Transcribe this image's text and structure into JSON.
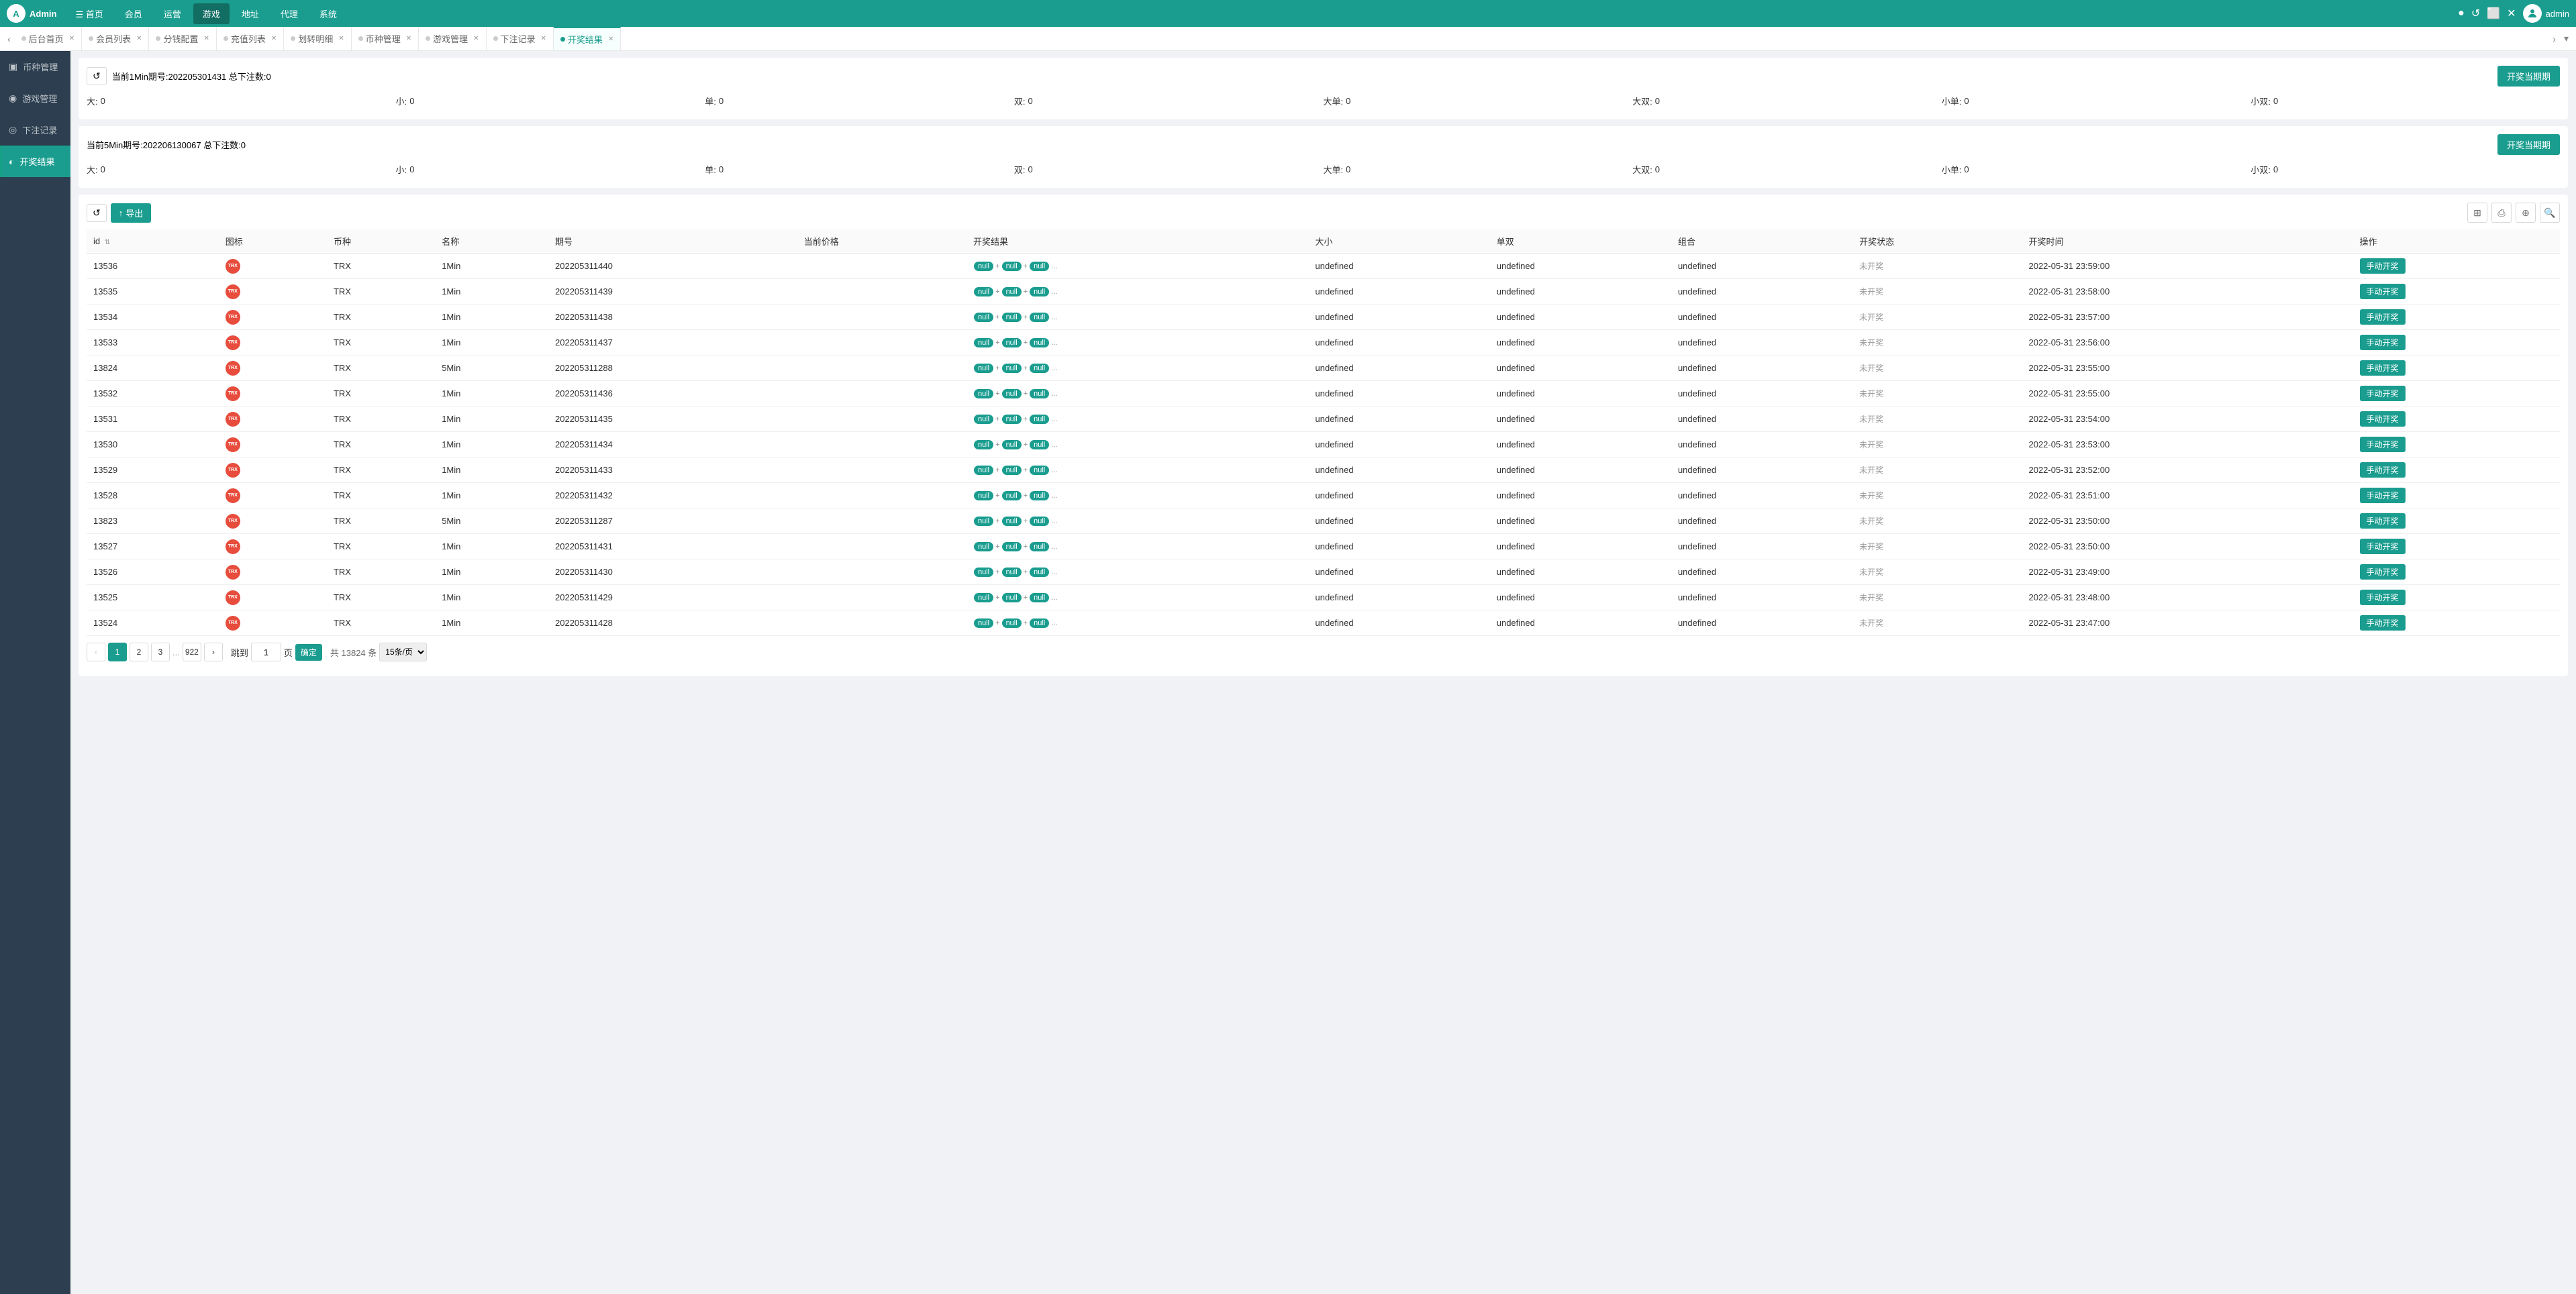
{
  "app": {
    "logo": "Admin",
    "logo_icon": "A"
  },
  "top_nav": {
    "items": [
      {
        "label": "首页",
        "icon": "☰",
        "active": false
      },
      {
        "label": "会员",
        "active": false
      },
      {
        "label": "运营",
        "active": false
      },
      {
        "label": "游戏",
        "active": true
      },
      {
        "label": "地址",
        "active": false
      },
      {
        "label": "代理",
        "active": false
      },
      {
        "label": "系统",
        "active": false
      }
    ],
    "user": "admin",
    "icons": [
      "●",
      "↺",
      "⬜",
      "✕"
    ]
  },
  "tabs": [
    {
      "label": "后台首页",
      "active": false,
      "dot": "gray",
      "closable": true
    },
    {
      "label": "会员列表",
      "active": false,
      "dot": "gray",
      "closable": true
    },
    {
      "label": "分钱配置",
      "active": false,
      "dot": "gray",
      "closable": true
    },
    {
      "label": "充值列表",
      "active": false,
      "dot": "gray",
      "closable": true
    },
    {
      "label": "划转明细",
      "active": false,
      "dot": "gray",
      "closable": true
    },
    {
      "label": "币种管理",
      "active": false,
      "dot": "gray",
      "closable": true
    },
    {
      "label": "游戏管理",
      "active": false,
      "dot": "gray",
      "closable": true
    },
    {
      "label": "下注记录",
      "active": false,
      "dot": "gray",
      "closable": true
    },
    {
      "label": "开奖结果",
      "active": true,
      "dot": "green",
      "closable": true
    }
  ],
  "sidebar": {
    "items": [
      {
        "label": "币种管理",
        "icon": "◈",
        "active": false
      },
      {
        "label": "游戏管理",
        "icon": "◉",
        "active": false
      },
      {
        "label": "下注记录",
        "icon": "◎",
        "active": false
      },
      {
        "label": "开奖结果",
        "icon": "◐",
        "active": true
      }
    ]
  },
  "period_1min": {
    "label": "当前1Min期号:202205301431 总下注数:0",
    "open_btn": "开奖当期期",
    "stats": [
      {
        "key": "大",
        "value": "0"
      },
      {
        "key": "小",
        "value": "0"
      },
      {
        "key": "单",
        "value": "0"
      },
      {
        "key": "双",
        "value": "0"
      },
      {
        "key": "大单",
        "value": "0"
      },
      {
        "key": "大双",
        "value": "0"
      },
      {
        "key": "小单",
        "value": "0"
      },
      {
        "key": "小双",
        "value": "0"
      }
    ]
  },
  "period_5min": {
    "label": "当前5Min期号:202206130067 总下注数:0",
    "open_btn": "开奖当期期",
    "stats": [
      {
        "key": "大",
        "value": "0"
      },
      {
        "key": "小",
        "value": "0"
      },
      {
        "key": "单",
        "value": "0"
      },
      {
        "key": "双",
        "value": "0"
      },
      {
        "key": "大单",
        "value": "0"
      },
      {
        "key": "大双",
        "value": "0"
      },
      {
        "key": "小单",
        "value": "0"
      },
      {
        "key": "小双",
        "value": "0"
      }
    ]
  },
  "toolbar": {
    "refresh_icon": "↺",
    "export_icon": "↑",
    "export_label": "导出",
    "tool_icons": [
      "⊞",
      "⎙",
      "⊕",
      "🔍"
    ]
  },
  "table": {
    "columns": [
      {
        "key": "id",
        "label": "id",
        "sortable": true
      },
      {
        "key": "icon",
        "label": "图标"
      },
      {
        "key": "currency",
        "label": "币种"
      },
      {
        "key": "name",
        "label": "名称"
      },
      {
        "key": "period",
        "label": "期号"
      },
      {
        "key": "price",
        "label": "当前价格"
      },
      {
        "key": "result",
        "label": "开奖结果"
      },
      {
        "key": "size",
        "label": "大小"
      },
      {
        "key": "parity",
        "label": "单双"
      },
      {
        "key": "combo",
        "label": "组合"
      },
      {
        "key": "status",
        "label": "开奖状态"
      },
      {
        "key": "time",
        "label": "开奖时间"
      },
      {
        "key": "action",
        "label": "操作"
      }
    ],
    "rows": [
      {
        "id": "13536",
        "currency": "TRX",
        "name": "1Min",
        "period": "202205311440",
        "price": "",
        "result_badges": [
          "null",
          "null",
          "null",
          "..."
        ],
        "size": "undefined",
        "parity": "undefined",
        "combo": "undefined",
        "status": "未开奖",
        "time": "2022-05-31 23:59:00",
        "action": "手动开奖",
        "action_active": true
      },
      {
        "id": "13535",
        "currency": "TRX",
        "name": "1Min",
        "period": "202205311439",
        "price": "",
        "result_badges": [
          "null",
          "null",
          "null",
          "..."
        ],
        "size": "undefined",
        "parity": "undefined",
        "combo": "undefined",
        "status": "未开奖",
        "time": "2022-05-31 23:58:00",
        "action": "手动开奖",
        "action_active": true
      },
      {
        "id": "13534",
        "currency": "TRX",
        "name": "1Min",
        "period": "202205311438",
        "price": "",
        "result_badges": [
          "null",
          "null",
          "null",
          "..."
        ],
        "size": "undefined",
        "parity": "undefined",
        "combo": "undefined",
        "status": "未开奖",
        "time": "2022-05-31 23:57:00",
        "action": "手动开奖",
        "action_active": true
      },
      {
        "id": "13533",
        "currency": "TRX",
        "name": "1Min",
        "period": "202205311437",
        "price": "",
        "result_badges": [
          "null",
          "null",
          "null",
          "..."
        ],
        "size": "undefined",
        "parity": "undefined",
        "combo": "undefined",
        "status": "未开奖",
        "time": "2022-05-31 23:56:00",
        "action": "手动开奖",
        "action_active": true
      },
      {
        "id": "13824",
        "currency": "TRX",
        "name": "5Min",
        "period": "202205311288",
        "price": "",
        "result_badges": [
          "null",
          "null",
          "null",
          "..."
        ],
        "size": "undefined",
        "parity": "undefined",
        "combo": "undefined",
        "status": "未开奖",
        "time": "2022-05-31 23:55:00",
        "action": "手动开奖",
        "action_active": true
      },
      {
        "id": "13532",
        "currency": "TRX",
        "name": "1Min",
        "period": "202205311436",
        "price": "",
        "result_badges": [
          "null",
          "null",
          "null",
          "..."
        ],
        "size": "undefined",
        "parity": "undefined",
        "combo": "undefined",
        "status": "未开奖",
        "time": "2022-05-31 23:55:00",
        "action": "手动开奖",
        "action_active": true
      },
      {
        "id": "13531",
        "currency": "TRX",
        "name": "1Min",
        "period": "202205311435",
        "price": "",
        "result_badges": [
          "null",
          "null",
          "null",
          "..."
        ],
        "size": "undefined",
        "parity": "undefined",
        "combo": "undefined",
        "status": "未开奖",
        "time": "2022-05-31 23:54:00",
        "action": "手动开奖",
        "action_active": true
      },
      {
        "id": "13530",
        "currency": "TRX",
        "name": "1Min",
        "period": "202205311434",
        "price": "",
        "result_badges": [
          "null",
          "null",
          "null",
          "..."
        ],
        "size": "undefined",
        "parity": "undefined",
        "combo": "undefined",
        "status": "未开奖",
        "time": "2022-05-31 23:53:00",
        "action": "手动开奖",
        "action_active": true
      },
      {
        "id": "13529",
        "currency": "TRX",
        "name": "1Min",
        "period": "202205311433",
        "price": "",
        "result_badges": [
          "null",
          "null",
          "null",
          "..."
        ],
        "size": "undefined",
        "parity": "undefined",
        "combo": "undefined",
        "status": "未开奖",
        "time": "2022-05-31 23:52:00",
        "action": "手动开奖",
        "action_active": true
      },
      {
        "id": "13528",
        "currency": "TRX",
        "name": "1Min",
        "period": "202205311432",
        "price": "",
        "result_badges": [
          "null",
          "null",
          "null",
          "..."
        ],
        "size": "undefined",
        "parity": "undefined",
        "combo": "undefined",
        "status": "未开奖",
        "time": "2022-05-31 23:51:00",
        "action": "手动开奖",
        "action_active": true
      },
      {
        "id": "13823",
        "currency": "TRX",
        "name": "5Min",
        "period": "202205311287",
        "price": "",
        "result_badges": [
          "null",
          "null",
          "null",
          "..."
        ],
        "size": "undefined",
        "parity": "undefined",
        "combo": "undefined",
        "status": "未开奖",
        "time": "2022-05-31 23:50:00",
        "action": "手动开奖",
        "action_active": true
      },
      {
        "id": "13527",
        "currency": "TRX",
        "name": "1Min",
        "period": "202205311431",
        "price": "",
        "result_badges": [
          "null",
          "null",
          "null",
          "..."
        ],
        "size": "undefined",
        "parity": "undefined",
        "combo": "undefined",
        "status": "未开奖",
        "time": "2022-05-31 23:50:00",
        "action": "手动开奖",
        "action_active": true
      },
      {
        "id": "13526",
        "currency": "TRX",
        "name": "1Min",
        "period": "202205311430",
        "price": "",
        "result_badges": [
          "null",
          "null",
          "null",
          "..."
        ],
        "size": "undefined",
        "parity": "undefined",
        "combo": "undefined",
        "status": "未开奖",
        "time": "2022-05-31 23:49:00",
        "action": "手动开奖",
        "action_active": true
      },
      {
        "id": "13525",
        "currency": "TRX",
        "name": "1Min",
        "period": "202205311429",
        "price": "",
        "result_badges": [
          "null",
          "null",
          "null",
          "..."
        ],
        "size": "undefined",
        "parity": "undefined",
        "combo": "undefined",
        "status": "未开奖",
        "time": "2022-05-31 23:48:00",
        "action": "手动开奖",
        "action_active": true
      },
      {
        "id": "13524",
        "currency": "TRX",
        "name": "1Min",
        "period": "202205311428",
        "price": "",
        "result_badges": [
          "null",
          "null",
          "null",
          "..."
        ],
        "size": "undefined",
        "parity": "undefined",
        "combo": "undefined",
        "status": "未开奖",
        "time": "2022-05-31 23:47:00",
        "action": "手动开奖",
        "action_active": true
      }
    ]
  },
  "pagination": {
    "current": 1,
    "pages": [
      1,
      2,
      3,
      "...",
      922
    ],
    "jump_label": "跳到",
    "jump_value": "1",
    "confirm_label": "确定",
    "total_label": "共 13824 条",
    "page_size_label": "15条/页",
    "prev_disabled": true,
    "next_disabled": false
  },
  "colors": {
    "teal": "#1a9d8f",
    "sidebar_bg": "#2c3e50",
    "red": "#e74c3c"
  }
}
